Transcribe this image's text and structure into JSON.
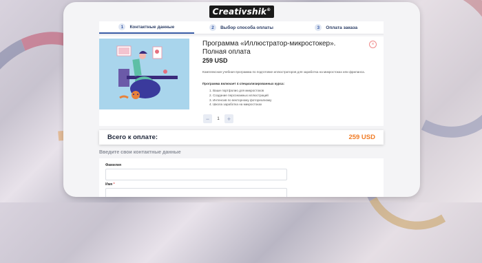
{
  "brand": {
    "logo_text": "Creativshik",
    "logo_mark": "®"
  },
  "steps": [
    {
      "num": "1",
      "label": "Контактные данные",
      "active": true
    },
    {
      "num": "2",
      "label": "Выбор способа оплаты",
      "active": false
    },
    {
      "num": "3",
      "label": "Оплата заказа",
      "active": false
    }
  ],
  "product": {
    "title": "Программа «Иллюстратор-микростокер». Полная оплата",
    "price": "259 USD",
    "description": "Комплексная учебная программа по подготовке иллюстраторов для заработка на микростоках или фриланса.",
    "includes_label": "Программа включает 4 специализированных курса:",
    "courses": [
      "1. Ваше портфолио для микростоков",
      "2. Создание персонажных иллюстраций",
      "3. Интенсив по векторному фотореализму",
      "4. Школа заработка на микростоках"
    ],
    "quantity": "1",
    "minus": "−",
    "plus": "+",
    "remove": "×"
  },
  "total": {
    "label": "Всего к оплате:",
    "value": "259 USD"
  },
  "contact": {
    "heading": "Введите свои контактные данные",
    "fields": [
      {
        "label": "Фамилия",
        "required": false
      },
      {
        "label": "Имя",
        "required": true,
        "req_mark": "*"
      }
    ]
  },
  "colors": {
    "accent": "#3b5ea8",
    "total_price": "#f07b24",
    "remove": "#f08a8a"
  }
}
